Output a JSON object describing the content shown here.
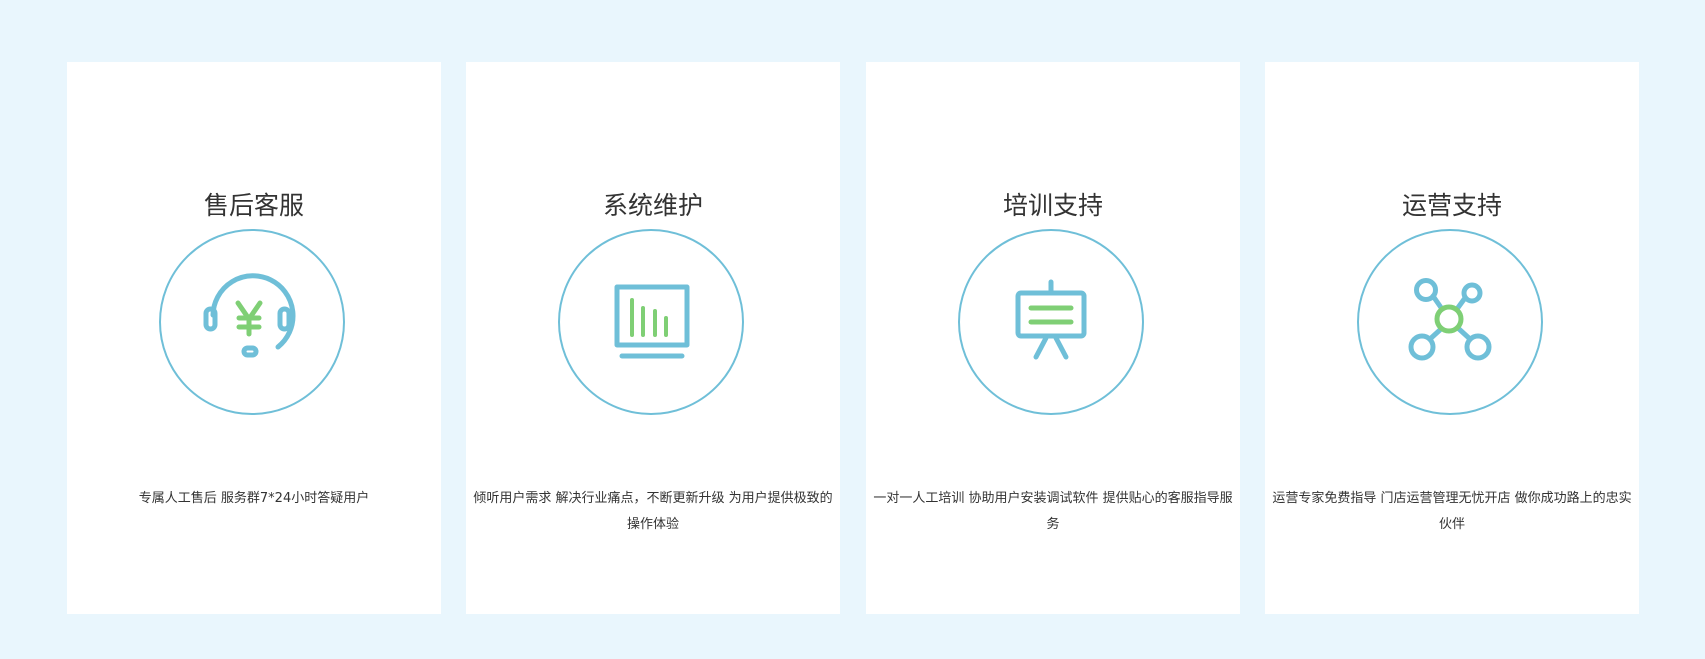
{
  "colors": {
    "background": "#e9f6fd",
    "card": "#ffffff",
    "icon_blue": "#6fbfd8",
    "icon_green": "#7fcf75",
    "text": "#333333"
  },
  "cards": [
    {
      "title": "售后客服",
      "icon": "headset-yen-icon",
      "description": "专属人工售后 服务群7*24小时答疑用户"
    },
    {
      "title": "系统维护",
      "icon": "monitor-chart-icon",
      "description": "倾听用户需求 解决行业痛点，不断更新升级 为用户提供极致的操作体验"
    },
    {
      "title": "培训支持",
      "icon": "presentation-board-icon",
      "description": "一对一人工培训 协助用户安装调试软件 提供贴心的客服指导服务"
    },
    {
      "title": "运营支持",
      "icon": "network-nodes-icon",
      "description": "运营专家免费指导 门店运营管理无忧开店 做你成功路上的忠实伙伴"
    }
  ]
}
